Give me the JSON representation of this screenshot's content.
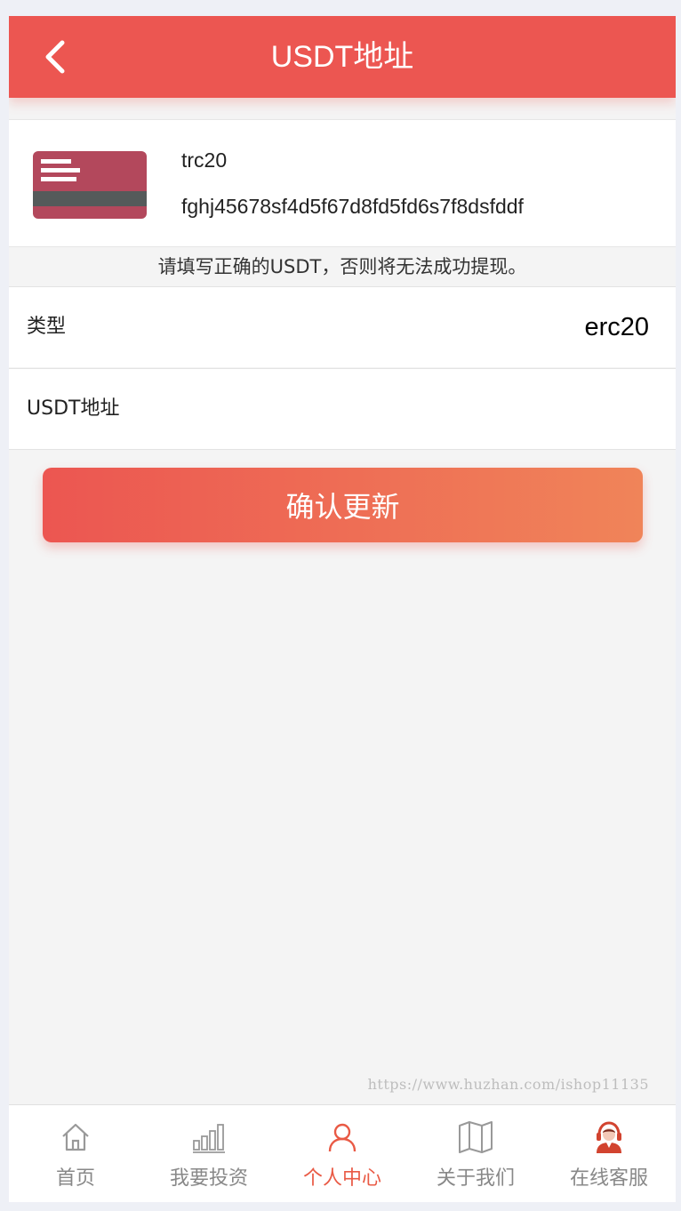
{
  "header": {
    "title": "USDT地址"
  },
  "card": {
    "type": "trc20",
    "address": "fghj45678sf4d5f67d8fd5fd6s7f8dsfddf"
  },
  "notice": "请填写正确的USDT，否则将无法成功提现。",
  "form": {
    "type_label": "类型",
    "type_value": "erc20",
    "address_label": "USDT地址",
    "address_value": "",
    "address_placeholder": ""
  },
  "submit_label": "确认更新",
  "watermark": "https://www.huzhan.com/ishop11135",
  "tabbar": {
    "items": [
      {
        "label": "首页",
        "icon": "home-icon"
      },
      {
        "label": "我要投资",
        "icon": "chart-icon"
      },
      {
        "label": "个人中心",
        "icon": "user-icon"
      },
      {
        "label": "关于我们",
        "icon": "map-icon"
      },
      {
        "label": "在线客服",
        "icon": "support-agent-icon"
      }
    ],
    "active_index": 2
  },
  "colors": {
    "primary": "#ec5651",
    "gradient_end": "#f08459",
    "active_tab": "#e95a45",
    "card_icon": "#b3485c"
  }
}
